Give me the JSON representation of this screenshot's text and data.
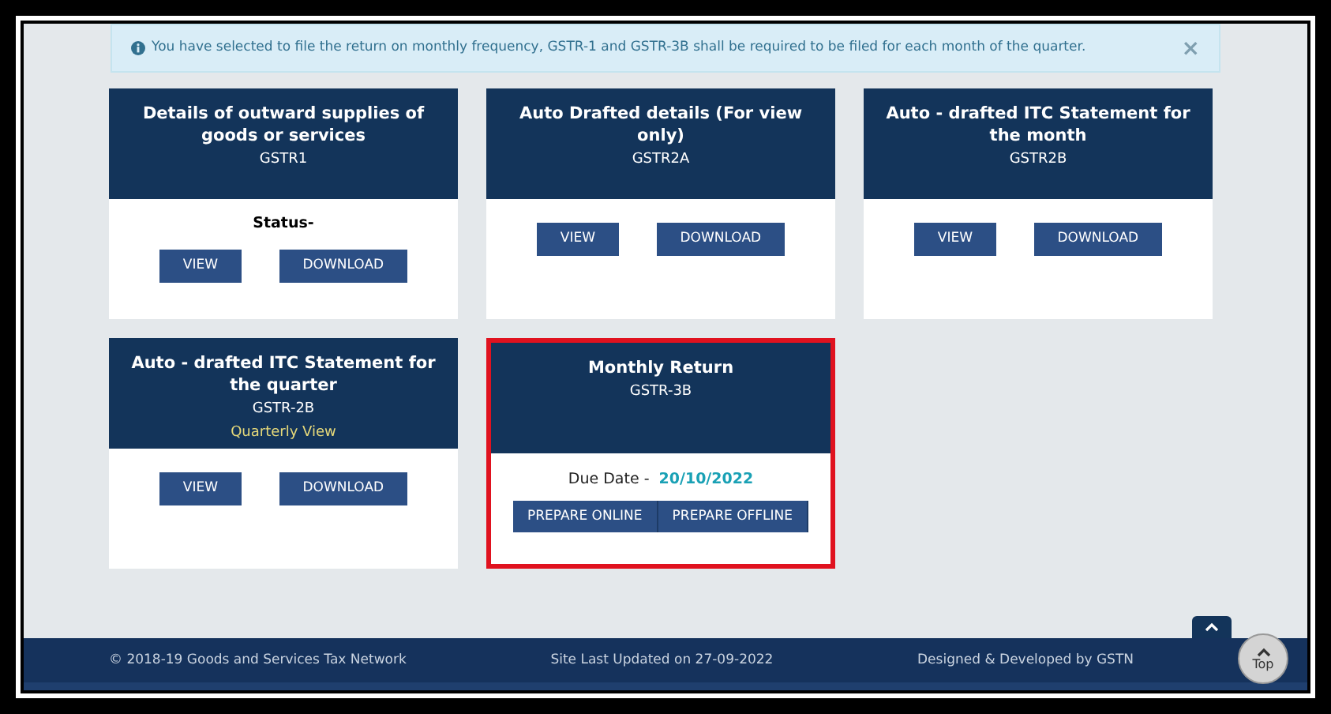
{
  "alert": {
    "text": "You have selected to file the return on monthly frequency, GSTR-1 and GSTR-3B shall be required to be filed for each month of the quarter.",
    "close": "×"
  },
  "cards": [
    {
      "title": "Details of outward supplies of goods or services",
      "code": "GSTR1",
      "status": "Status-",
      "highlighted": false,
      "buttons": [
        {
          "label": "VIEW"
        },
        {
          "label": "DOWNLOAD"
        }
      ]
    },
    {
      "title": "Auto Drafted details (For view only)",
      "code": "GSTR2A",
      "highlighted": false,
      "buttons": [
        {
          "label": "VIEW"
        },
        {
          "label": "DOWNLOAD"
        }
      ]
    },
    {
      "title": "Auto - drafted ITC Statement for the month",
      "code": "GSTR2B",
      "highlighted": false,
      "buttons": [
        {
          "label": "VIEW"
        },
        {
          "label": "DOWNLOAD"
        }
      ]
    },
    {
      "title": "Auto - drafted ITC Statement for the quarter",
      "code": "GSTR-2B",
      "note": "Quarterly View",
      "highlighted": false,
      "buttons": [
        {
          "label": "VIEW"
        },
        {
          "label": "DOWNLOAD"
        }
      ]
    },
    {
      "title": "Monthly Return",
      "code": "GSTR-3B",
      "due_label": "Due Date -",
      "due_date": "20/10/2022",
      "highlighted": true,
      "buttons": [
        {
          "label": "PREPARE ONLINE"
        },
        {
          "label": "PREPARE OFFLINE"
        }
      ]
    }
  ],
  "footer": {
    "copyright": "© 2018-19 Goods and Services Tax Network",
    "updated": "Site Last Updated on 27-09-2022",
    "credits": "Designed & Developed by GSTN",
    "top_label": "Top"
  }
}
